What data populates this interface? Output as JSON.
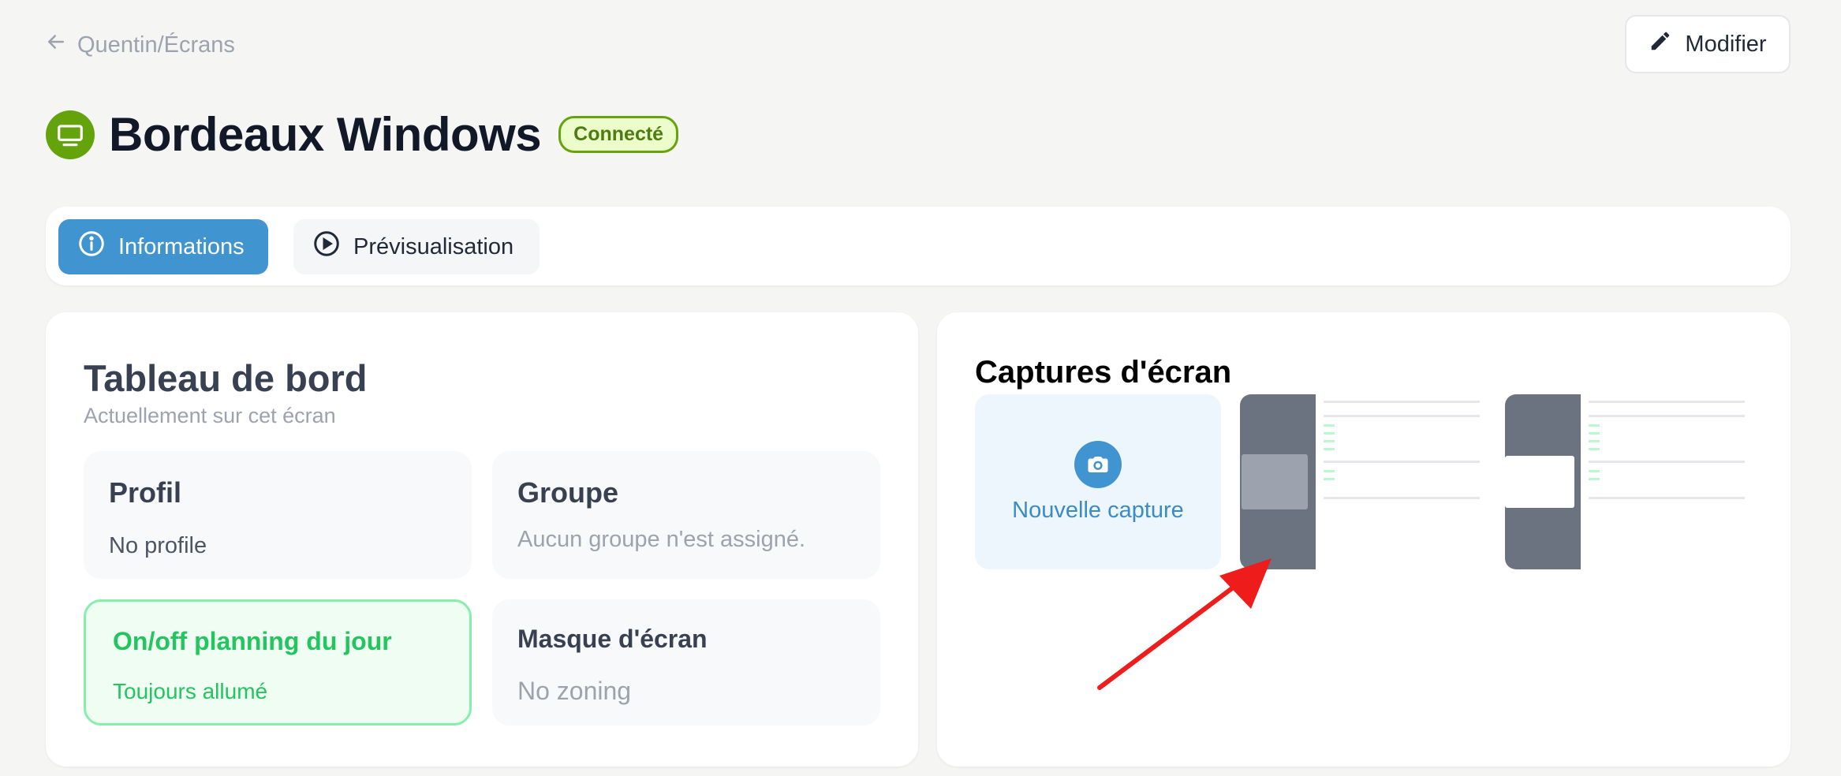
{
  "breadcrumb": {
    "text": "Quentin/Écrans"
  },
  "header": {
    "edit_label": "Modifier",
    "title": "Bordeaux Windows",
    "status": "Connecté"
  },
  "tabs": [
    {
      "label": "Informations",
      "icon": "info-icon",
      "active": true
    },
    {
      "label": "Prévisualisation",
      "icon": "play-icon",
      "active": false
    }
  ],
  "dashboard": {
    "title": "Tableau de bord",
    "subtitle": "Actuellement sur cet écran",
    "tiles": {
      "profil": {
        "title": "Profil",
        "value": "No profile"
      },
      "groupe": {
        "title": "Groupe",
        "value": "Aucun groupe n'est assigné."
      },
      "planning": {
        "title": "On/off planning du jour",
        "value": "Toujours allumé"
      },
      "masque": {
        "title": "Masque d'écran",
        "value": "No zoning"
      }
    }
  },
  "screenshots": {
    "title": "Captures d'écran",
    "new_capture_label": "Nouvelle capture",
    "thumbnail_count": 2
  },
  "colors": {
    "accent": "#4094d0",
    "status_green": "#65a30d",
    "annotation_red": "#ef1c1c"
  }
}
